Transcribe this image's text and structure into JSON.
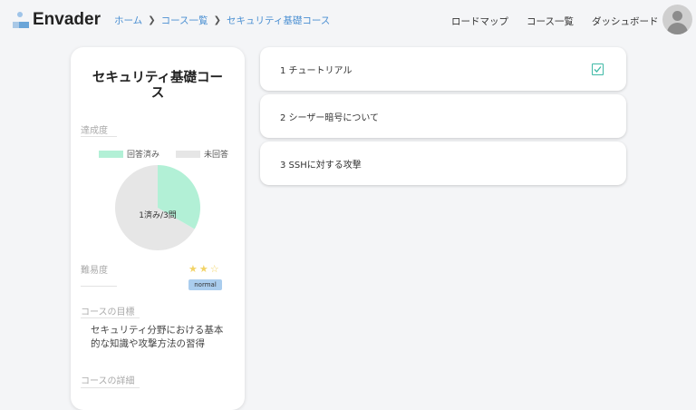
{
  "logo": {
    "text": "Envader"
  },
  "breadcrumb": {
    "items": [
      "ホーム",
      "コース一覧",
      "セキュリティ基礎コース"
    ]
  },
  "nav": {
    "items": [
      "ロードマップ",
      "コース一覧",
      "ダッシュボード"
    ]
  },
  "course": {
    "title": "セキュリティ基礎コース",
    "progress": {
      "label": "達成度",
      "legend_done": "回答済み",
      "legend_todo": "未回答",
      "summary": "1済み/3問",
      "done": 1,
      "total": 3,
      "colors": {
        "done": "#b2f0d6",
        "todo": "#e6e6e6"
      }
    },
    "difficulty": {
      "label": "難易度",
      "stars": "★★☆",
      "rating": 2,
      "max": 3,
      "level": "normal"
    },
    "goal": {
      "label": "コースの目標",
      "text": "セキュリティ分野における基本的な知識や攻撃方法の習得"
    },
    "detail": {
      "label": "コースの詳細"
    }
  },
  "chapters": [
    {
      "label": "1 チュートリアル",
      "completed": true
    },
    {
      "label": "2 シーザー暗号について",
      "completed": false
    },
    {
      "label": "3 SSHに対する攻撃",
      "completed": false
    }
  ],
  "colors": {
    "accent": "#4a8fd2",
    "check": "#3fb9a6",
    "badge": "#aacdee"
  }
}
